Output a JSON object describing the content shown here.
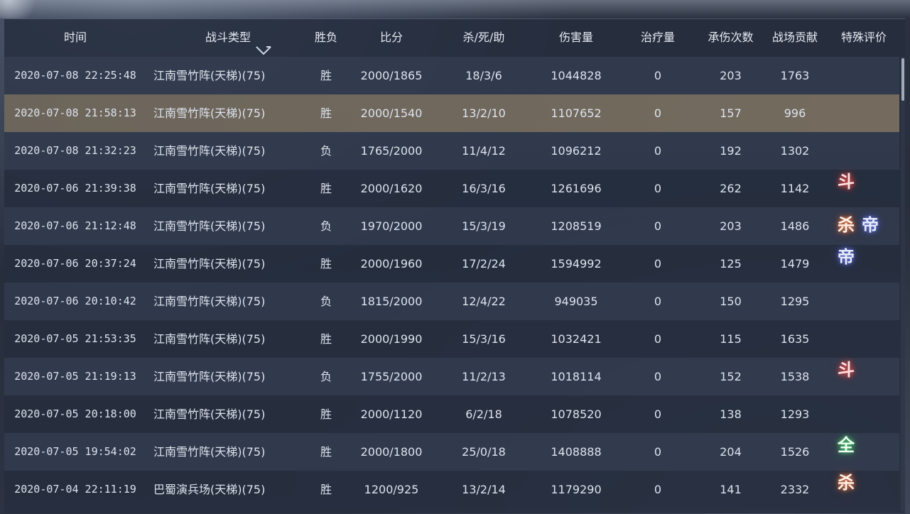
{
  "header": {
    "time": "时间",
    "battle_type": "战斗类型",
    "result": "胜负",
    "score": "比分",
    "kda": "杀/死/助",
    "damage": "伤害量",
    "healing": "治疗量",
    "hits_taken": "承伤次数",
    "contribution": "战场贡献",
    "special": "特殊评价"
  },
  "rows": [
    {
      "time": "2020-07-08 22:25:48",
      "type": "江南雪竹阵(天梯)(75)",
      "result": "胜",
      "score": "2000/1865",
      "kda": "18/3/6",
      "damage": "1044828",
      "healing": "0",
      "hits": "203",
      "contrib": "1763",
      "badges": []
    },
    {
      "time": "2020-07-08 21:58:13",
      "type": "江南雪竹阵(天梯)(75)",
      "result": "胜",
      "score": "2000/1540",
      "kda": "13/2/10",
      "damage": "1107652",
      "healing": "0",
      "hits": "157",
      "contrib": "996",
      "badges": []
    },
    {
      "time": "2020-07-08 21:32:23",
      "type": "江南雪竹阵(天梯)(75)",
      "result": "负",
      "score": "1765/2000",
      "kda": "11/4/12",
      "damage": "1096212",
      "healing": "0",
      "hits": "192",
      "contrib": "1302",
      "badges": []
    },
    {
      "time": "2020-07-06 21:39:38",
      "type": "江南雪竹阵(天梯)(75)",
      "result": "胜",
      "score": "2000/1620",
      "kda": "16/3/16",
      "damage": "1261696",
      "healing": "0",
      "hits": "262",
      "contrib": "1142",
      "badges": [
        {
          "char": "斗",
          "style": "dou"
        }
      ]
    },
    {
      "time": "2020-07-06 21:12:48",
      "type": "江南雪竹阵(天梯)(75)",
      "result": "负",
      "score": "1970/2000",
      "kda": "15/3/19",
      "damage": "1208519",
      "healing": "0",
      "hits": "203",
      "contrib": "1486",
      "badges": [
        {
          "char": "杀",
          "style": "sha"
        },
        {
          "char": "帝",
          "style": "di"
        }
      ]
    },
    {
      "time": "2020-07-06 20:37:24",
      "type": "江南雪竹阵(天梯)(75)",
      "result": "胜",
      "score": "2000/1960",
      "kda": "17/2/24",
      "damage": "1594992",
      "healing": "0",
      "hits": "125",
      "contrib": "1479",
      "badges": [
        {
          "char": "帝",
          "style": "di"
        }
      ]
    },
    {
      "time": "2020-07-06 20:10:42",
      "type": "江南雪竹阵(天梯)(75)",
      "result": "负",
      "score": "1815/2000",
      "kda": "12/4/22",
      "damage": "949035",
      "healing": "0",
      "hits": "150",
      "contrib": "1295",
      "badges": []
    },
    {
      "time": "2020-07-05 21:53:35",
      "type": "江南雪竹阵(天梯)(75)",
      "result": "胜",
      "score": "2000/1990",
      "kda": "15/3/16",
      "damage": "1032421",
      "healing": "0",
      "hits": "115",
      "contrib": "1635",
      "badges": []
    },
    {
      "time": "2020-07-05 21:19:13",
      "type": "江南雪竹阵(天梯)(75)",
      "result": "负",
      "score": "1755/2000",
      "kda": "11/2/13",
      "damage": "1018114",
      "healing": "0",
      "hits": "152",
      "contrib": "1538",
      "badges": [
        {
          "char": "斗",
          "style": "dou"
        }
      ]
    },
    {
      "time": "2020-07-05 20:18:00",
      "type": "江南雪竹阵(天梯)(75)",
      "result": "胜",
      "score": "2000/1120",
      "kda": "6/2/18",
      "damage": "1078520",
      "healing": "0",
      "hits": "138",
      "contrib": "1293",
      "badges": []
    },
    {
      "time": "2020-07-05 19:54:02",
      "type": "江南雪竹阵(天梯)(75)",
      "result": "胜",
      "score": "2000/1800",
      "kda": "25/0/18",
      "damage": "1408888",
      "healing": "0",
      "hits": "204",
      "contrib": "1526",
      "badges": [
        {
          "char": "全",
          "style": "quan"
        }
      ]
    },
    {
      "time": "2020-07-04 22:11:19",
      "type": "巴蜀演兵场(天梯)(75)",
      "result": "胜",
      "score": "1200/925",
      "kda": "13/2/14",
      "damage": "1179290",
      "healing": "0",
      "hits": "141",
      "contrib": "2332",
      "badges": [
        {
          "char": "杀",
          "style": "sha"
        }
      ]
    }
  ],
  "selected_row": 1,
  "icons": {
    "sort": "chevron-down-icon"
  }
}
